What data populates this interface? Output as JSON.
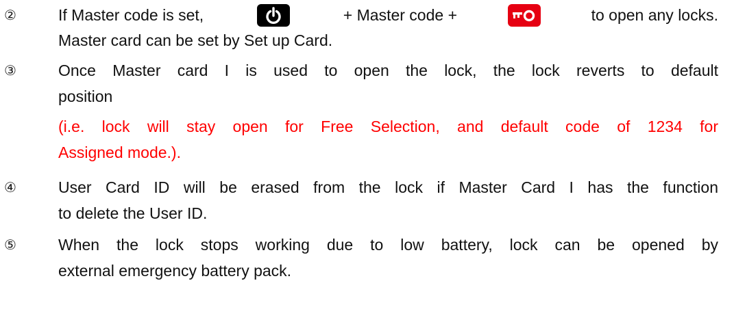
{
  "items": [
    {
      "number": "②",
      "lines": [
        {
          "a": "If Master code is set,",
          "b": "+ Master code +",
          "c": "to open any locks."
        },
        "Master card can be set by Set up Card."
      ]
    },
    {
      "number": "③",
      "lines": [
        "Once Master card I is used to open the lock, the lock reverts to default",
        "position"
      ],
      "note_lines": [
        "(i.e. lock will stay open for Free Selection, and default code of 1234 for",
        "Assigned mode.)."
      ]
    },
    {
      "number": "④",
      "lines": [
        "User Card ID will be erased from the lock if Master Card I has the function",
        "to delete the User ID."
      ]
    },
    {
      "number": "⑤",
      "lines": [
        "When the lock stops working due to low battery, lock can be opened by",
        "external emergency battery pack."
      ]
    }
  ],
  "icons": {
    "power_key": "power-icon",
    "enter_key": "key-icon"
  },
  "colors": {
    "text": "#111111",
    "note": "#ff0000",
    "power_key_bg": "#000000",
    "enter_key_bg": "#e60012"
  }
}
